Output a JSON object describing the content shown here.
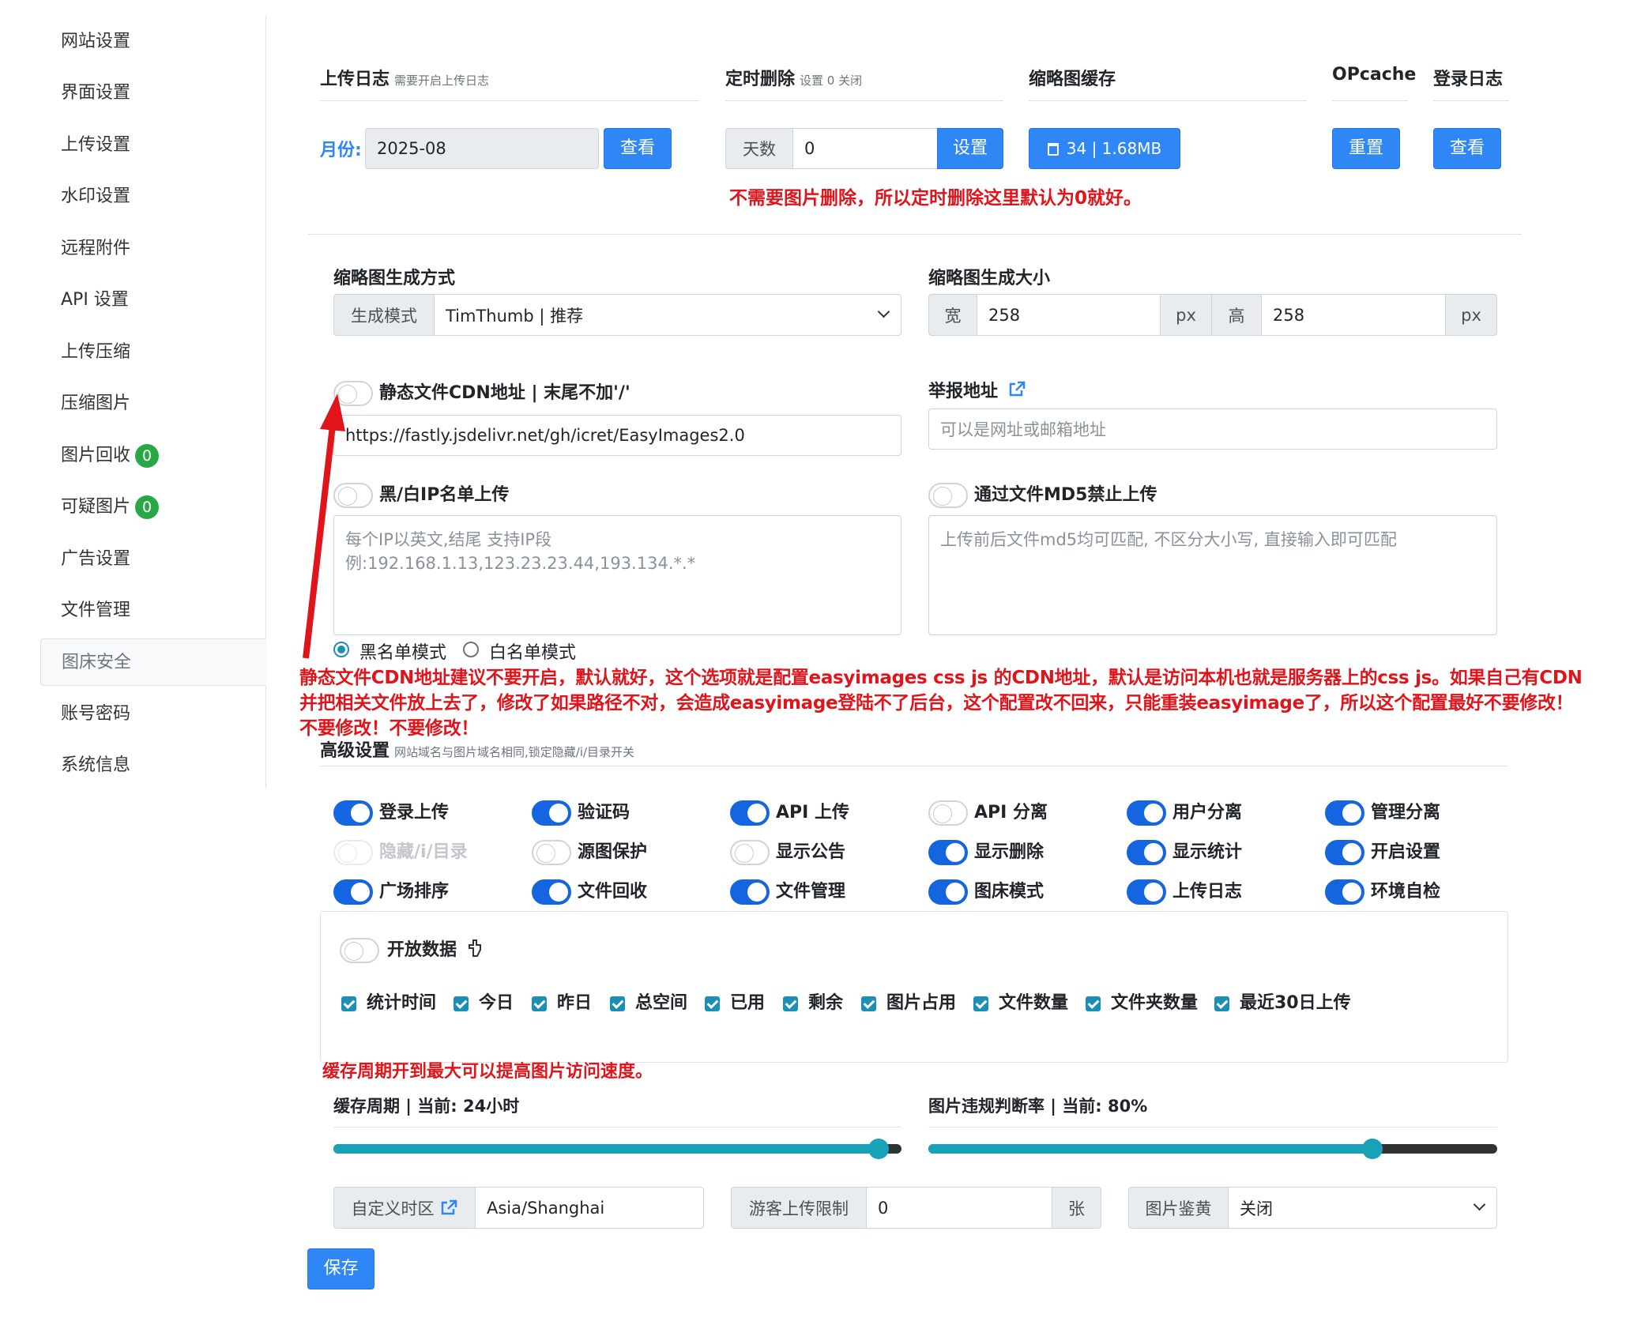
{
  "sidebar": {
    "items": [
      {
        "label": "网站设置"
      },
      {
        "label": "界面设置"
      },
      {
        "label": "上传设置"
      },
      {
        "label": "水印设置"
      },
      {
        "label": "远程附件"
      },
      {
        "label": "API 设置"
      },
      {
        "label": "上传压缩"
      },
      {
        "label": "压缩图片"
      },
      {
        "label": "图片回收",
        "badge": "0"
      },
      {
        "label": "可疑图片",
        "badge": "0"
      },
      {
        "label": "广告设置"
      },
      {
        "label": "文件管理"
      },
      {
        "label": "图床安全"
      },
      {
        "label": "账号密码"
      },
      {
        "label": "系统信息"
      }
    ]
  },
  "upload_log": {
    "title": "上传日志",
    "hint": "需要开启上传日志",
    "month_label": "月份:",
    "month_value": "2025-08",
    "view_button": "查看"
  },
  "timed_delete": {
    "title": "定时删除",
    "hint": "设置 0 关闭",
    "days_label": "天数",
    "days_value": "0",
    "set_button": "设置",
    "note": "不需要图片删除，所以定时删除这里默认为0就好。"
  },
  "thumb_cache": {
    "title": "缩略图缓存",
    "button": "34 | 1.68MB"
  },
  "opcache": {
    "title": "OPcache",
    "button": "重置"
  },
  "login_log": {
    "title": "登录日志",
    "button": "查看"
  },
  "thumb_mode": {
    "title": "缩略图生成方式",
    "label": "生成模式",
    "value": "TimThumb | 推荐"
  },
  "thumb_size": {
    "title": "缩略图生成大小",
    "width_label": "宽",
    "width_value": "258",
    "unit": "px",
    "height_label": "高",
    "height_value": "258"
  },
  "cdn": {
    "title": "静态文件CDN地址 | 末尾不加'/'",
    "value": "https://fastly.jsdelivr.net/gh/icret/EasyImages2.0",
    "enabled": false
  },
  "report": {
    "title": "举报地址",
    "placeholder": "可以是网址或邮箱地址"
  },
  "ip_list": {
    "title": "黑/白IP名单上传",
    "placeholder": "每个IP以英文,结尾 支持IP段 例:192.168.1.13,123.23.23.44,193.134.*.*",
    "mode_black": "黑名单模式",
    "mode_white": "白名单模式",
    "enabled": false
  },
  "md5": {
    "title": "通过文件MD5禁止上传",
    "placeholder": "上传前后文件md5均可匹配, 不区分大小写, 直接输入即可匹配",
    "enabled": false
  },
  "cdn_warning": {
    "line1": "静态文件CDN地址建议不要开启，默认就好，这个选项就是配置easyimages css js 的CDN地址，默认是访问本机也就是服务器上的css js。如果自己有CDN",
    "line2": "并把相关文件放上去了，修改了如果路径不对，会造成easyimage登陆不了后台，这个配置改不回来，只能重装easyimage了，所以这个配置最好不要修改！",
    "line3": "不要修改！不要修改！"
  },
  "advanced": {
    "title": "高级设置",
    "hint": "网站域名与图片域名相同,锁定隐藏/i/目录开关",
    "switches": [
      {
        "label": "登录上传",
        "on": true
      },
      {
        "label": "验证码",
        "on": true
      },
      {
        "label": "API 上传",
        "on": true
      },
      {
        "label": "API 分离",
        "on": false
      },
      {
        "label": "用户分离",
        "on": true
      },
      {
        "label": "管理分离",
        "on": true
      },
      {
        "label": "隐藏/i/目录",
        "on": false,
        "disabled": true
      },
      {
        "label": "源图保护",
        "on": false
      },
      {
        "label": "显示公告",
        "on": false
      },
      {
        "label": "显示删除",
        "on": true
      },
      {
        "label": "显示统计",
        "on": true
      },
      {
        "label": "开启设置",
        "on": true
      },
      {
        "label": "广场排序",
        "on": true
      },
      {
        "label": "文件回收",
        "on": true
      },
      {
        "label": "文件管理",
        "on": true
      },
      {
        "label": "图床模式",
        "on": true
      },
      {
        "label": "上传日志",
        "on": true
      },
      {
        "label": "环境自检",
        "on": true
      }
    ]
  },
  "open_data": {
    "title": "开放数据",
    "enabled": false,
    "checks": [
      "统计时间",
      "今日",
      "昨日",
      "总空间",
      "已用",
      "剩余",
      "图片占用",
      "文件数量",
      "文件夹数量",
      "最近30日上传"
    ]
  },
  "cache_note": "缓存周期开到最大可以提高图片访问速度。",
  "cache_period": {
    "label": "缓存周期 | 当前: 24小时",
    "fraction": 0.96
  },
  "violation_rate": {
    "label": "图片违规判断率 | 当前: 80%",
    "fraction": 0.78
  },
  "timezone": {
    "label": "自定义时区",
    "value": "Asia/Shanghai"
  },
  "guest_limit": {
    "label": "游客上传限制",
    "value": "0",
    "unit": "张"
  },
  "image_check": {
    "label": "图片鉴黄",
    "value": "关闭"
  },
  "save_button": "保存",
  "colors": {
    "primary": "#2f86f5",
    "switch_on": "#1565e0",
    "slider": "#17a2b8",
    "annotation": "#e0151b",
    "badge": "#28a745"
  }
}
